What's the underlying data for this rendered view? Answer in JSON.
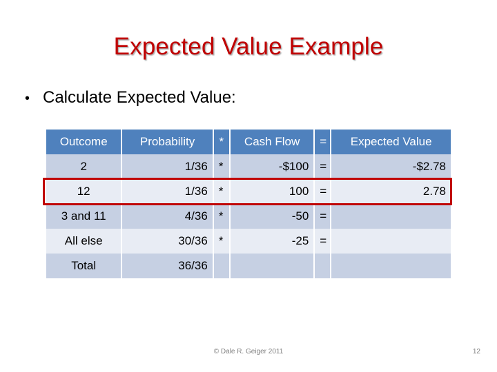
{
  "slide": {
    "title": "Expected Value Example",
    "title_color": "#c00000",
    "background_color": "#ffffff"
  },
  "bullets": [
    {
      "marker": "•",
      "text": "Calculate Expected Value:"
    }
  ],
  "table": {
    "header_bg": "#4f81bd",
    "header_text_color": "#ffffff",
    "row_dark_bg": "#c6d0e3",
    "row_light_bg": "#e8ecf4",
    "columns": [
      "Outcome",
      "Probability",
      "*",
      "Cash Flow",
      "=",
      "Expected Value"
    ],
    "rows": [
      {
        "outcome": "2",
        "probability": "1/36",
        "op": "*",
        "cash_flow": "-$100",
        "eq": "=",
        "expected_value": "-$2.78"
      },
      {
        "outcome": "12",
        "probability": "1/36",
        "op": "*",
        "cash_flow": "100",
        "eq": "=",
        "expected_value": "2.78"
      },
      {
        "outcome": "3 and 11",
        "probability": "4/36",
        "op": "*",
        "cash_flow": "-50",
        "eq": "=",
        "expected_value": ""
      },
      {
        "outcome": "All else",
        "probability": "30/36",
        "op": "*",
        "cash_flow": "-25",
        "eq": "=",
        "expected_value": ""
      },
      {
        "outcome": "Total",
        "probability": "36/36",
        "op": "",
        "cash_flow": "",
        "eq": "",
        "expected_value": ""
      }
    ],
    "highlight": {
      "row_index": 1,
      "color": "#c00000"
    }
  },
  "footer": {
    "copyright": "© Dale R. Geiger 2011",
    "page_number": "12"
  }
}
